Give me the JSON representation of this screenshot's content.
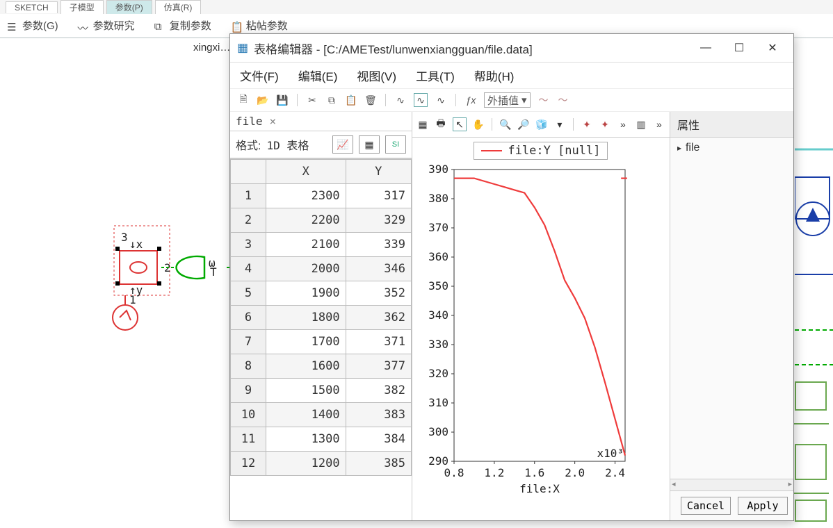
{
  "ribbon": {
    "tabs": [
      "SKETCH",
      "子模型",
      "参数(P)",
      "仿真(R)"
    ],
    "active_tab_index": 2,
    "cmds": [
      {
        "icon": "list-icon",
        "label": "参数(G)"
      },
      {
        "icon": "wave-icon",
        "label": "参数研究"
      },
      {
        "icon": "copy-icon",
        "label": "复制参数"
      },
      {
        "icon": "paste-icon",
        "label": "粘帖参数"
      }
    ]
  },
  "canvas": {
    "doc_name": "xingxi…"
  },
  "dialog": {
    "title_prefix": "表格编辑器 - ",
    "path": "[C:/AMETest/lunwenxiangguan/file.data]",
    "menus": [
      "文件(F)",
      "编辑(E)",
      "视图(V)",
      "工具(T)",
      "帮助(H)"
    ],
    "toolbar_dd": "外插值",
    "file_tab": "file",
    "format_label": "格式:",
    "format_value": "1D 表格",
    "buttons": {
      "cancel": "Cancel",
      "apply": "Apply"
    },
    "props_header": "属性",
    "props_root": "file"
  },
  "table": {
    "cols": [
      "X",
      "Y"
    ],
    "rows": [
      [
        2300,
        317
      ],
      [
        2200,
        329
      ],
      [
        2100,
        339
      ],
      [
        2000,
        346
      ],
      [
        1900,
        352
      ],
      [
        1800,
        362
      ],
      [
        1700,
        371
      ],
      [
        1600,
        377
      ],
      [
        1500,
        382
      ],
      [
        1400,
        383
      ],
      [
        1300,
        384
      ],
      [
        1200,
        385
      ]
    ]
  },
  "chart_data": {
    "type": "line",
    "title": "",
    "legend": "file:Y [null]",
    "xlabel": "file:X",
    "ylabel": "",
    "x_annotation": "x10³",
    "x_ticks": [
      0.8,
      1.2,
      1.6,
      2.0,
      2.4
    ],
    "y_ticks": [
      290,
      300,
      310,
      320,
      330,
      340,
      350,
      360,
      370,
      380,
      390
    ],
    "xlim": [
      0.8,
      2.5
    ],
    "ylim": [
      290,
      390
    ],
    "series": [
      {
        "name": "file:Y [null]",
        "color": "#ef3b3b",
        "x": [
          0.8,
          1.0,
          1.2,
          1.3,
          1.4,
          1.5,
          1.6,
          1.7,
          1.8,
          1.9,
          2.0,
          2.1,
          2.2,
          2.3,
          2.5
        ],
        "y": [
          387,
          387,
          385,
          384,
          383,
          382,
          377,
          371,
          362,
          352,
          346,
          339,
          329,
          317,
          292
        ]
      },
      {
        "name": "marker",
        "color": "#ef3b3b",
        "x": [
          2.46,
          2.52
        ],
        "y": [
          387,
          387
        ]
      }
    ]
  }
}
